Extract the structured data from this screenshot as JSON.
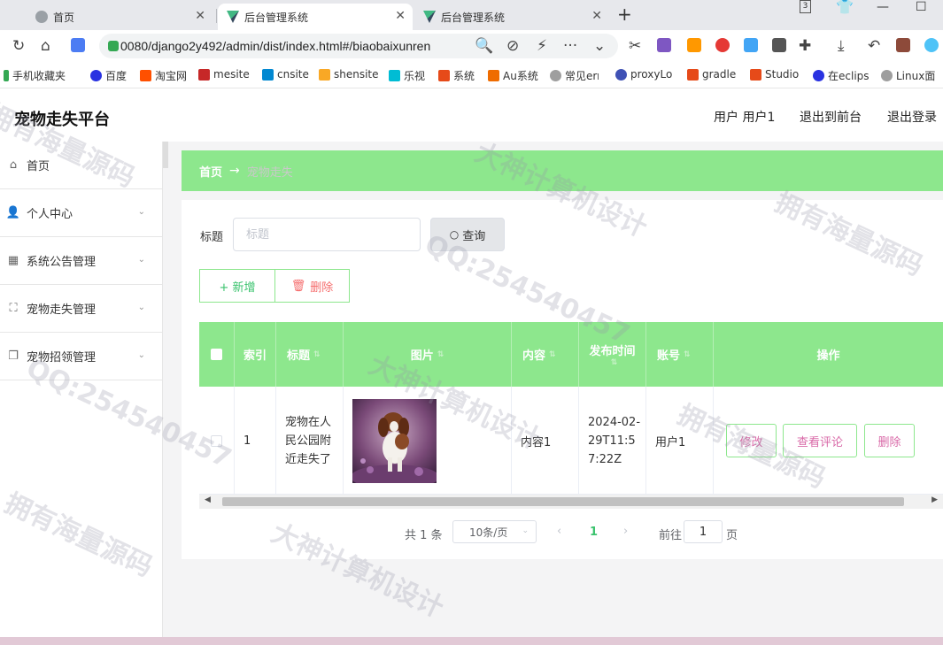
{
  "browser": {
    "tabs": [
      {
        "label": "首页"
      },
      {
        "label": "后台管理系统"
      },
      {
        "label": "后台管理系统"
      }
    ],
    "new_tab": "+",
    "tab_count": "3",
    "url": "0080/django2y492/admin/dist/index.html#/biaobaixunren",
    "bookmarks": [
      "手机收藏夹",
      "百度",
      "淘宝网",
      "mesite",
      "cnsite",
      "shensite",
      "乐视",
      "系统",
      "Au系统",
      "常见err",
      "proxyLo",
      "gradle",
      "Studio",
      "在eclips",
      "Linux面"
    ]
  },
  "header": {
    "title": "宠物走失平台",
    "user_label": "用户 用户1",
    "to_front": "退出到前台",
    "logout": "退出登录"
  },
  "sidebar": {
    "items": [
      {
        "label": "首页",
        "icon": "home-icon"
      },
      {
        "label": "个人中心",
        "icon": "user-icon"
      },
      {
        "label": "系统公告管理",
        "icon": "grid-icon"
      },
      {
        "label": "宠物走失管理",
        "icon": "frame-icon"
      },
      {
        "label": "宠物招领管理",
        "icon": "copy-icon"
      }
    ]
  },
  "breadcrumb": {
    "home": "首页",
    "current": "宠物走失"
  },
  "search": {
    "label": "标题",
    "placeholder": "标题",
    "value": "",
    "button": "查询"
  },
  "actions": {
    "add": "+ 新增",
    "delete": "删除"
  },
  "table": {
    "headers": [
      "索引",
      "标题",
      "图片",
      "内容",
      "发布时间",
      "账号",
      "操作"
    ],
    "rows": [
      {
        "index": "1",
        "title": "宠物在人民公园附近走失了",
        "content": "内容1",
        "time": "2024-02-29T11:57:22Z",
        "account": "用户1",
        "ops": [
          "修改",
          "查看评论",
          "删除"
        ]
      }
    ]
  },
  "pagination": {
    "total": "共 1 条",
    "page_size": "10条/页",
    "current": "1",
    "goto": "前往",
    "goto_value": "1",
    "page_unit": "页"
  },
  "watermarks": [
    "拥有海量源码",
    "QQ:254540457",
    "大神计算机设计"
  ],
  "colors": {
    "accent": "#8de78d",
    "accent_text": "#3bc36e",
    "danger": "#f56c6c",
    "op_text": "#d96aa8"
  }
}
